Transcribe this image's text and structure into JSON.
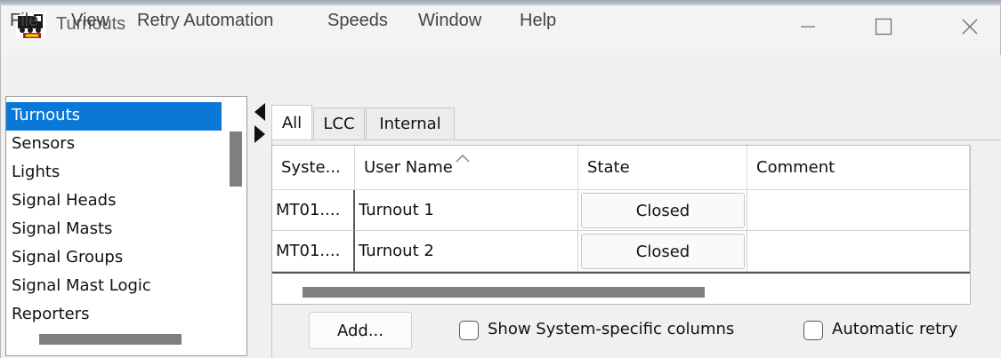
{
  "window": {
    "title": "Turnouts",
    "icon": "jmri-locomotive-icon",
    "controls": [
      "minimize",
      "maximize",
      "close"
    ]
  },
  "menubar": [
    "File",
    "View",
    "Retry Automation",
    "Speeds",
    "Window",
    "Help"
  ],
  "sidebar": {
    "items": [
      {
        "label": "Turnouts",
        "selected": true
      },
      {
        "label": "Sensors"
      },
      {
        "label": "Lights"
      },
      {
        "label": "Signal Heads"
      },
      {
        "label": "Signal Masts"
      },
      {
        "label": "Signal Groups"
      },
      {
        "label": "Signal Mast Logic"
      },
      {
        "label": "Reporters"
      }
    ]
  },
  "tabs": [
    {
      "label": "All",
      "selected": true
    },
    {
      "label": "LCC"
    },
    {
      "label": "Internal"
    }
  ],
  "table": {
    "columns": [
      "Syste...",
      "User Name",
      "State",
      "Comment"
    ],
    "sort_indicator": "^",
    "rows": [
      {
        "system": "MT01....",
        "user_name": "Turnout 1",
        "state": "Closed",
        "comment": ""
      },
      {
        "system": "MT01....",
        "user_name": "Turnout 2",
        "state": "Closed",
        "comment": ""
      }
    ]
  },
  "footer": {
    "add_label": "Add...",
    "show_system_columns_label": "Show System-specific columns",
    "show_system_columns_checked": false,
    "automatic_retry_label": "Automatic retry",
    "automatic_retry_checked": false
  },
  "colors": {
    "selection": "#0a78d7",
    "window_bg": "#f0f0f0"
  }
}
